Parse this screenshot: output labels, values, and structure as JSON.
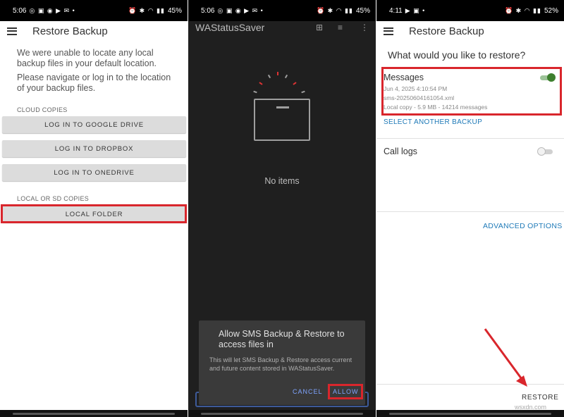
{
  "panel1": {
    "status": {
      "time": "5:06",
      "battery": "45%"
    },
    "appbar": {
      "title": "Restore Backup"
    },
    "message": {
      "line1": "We were unable to locate any local backup files in your default location.",
      "line2": "Please navigate or log in to the location of your backup files."
    },
    "cloud_label": "CLOUD COPIES",
    "buttons": [
      "LOG IN TO GOOGLE DRIVE",
      "LOG IN TO DROPBOX",
      "LOG IN TO ONEDRIVE"
    ],
    "local_label": "LOCAL OR SD COPIES",
    "local_button": "LOCAL FOLDER"
  },
  "panel2": {
    "status": {
      "time": "5:06",
      "battery": "45%"
    },
    "appbar": {
      "title": "WAStatusSaver"
    },
    "empty_text": "No items",
    "dialog": {
      "title": "Allow SMS Backup & Restore to access files in",
      "body": "This will let SMS Backup & Restore access current and future content stored in WAStatusSaver.",
      "cancel": "CANCEL",
      "allow": "ALLOW"
    }
  },
  "panel3": {
    "status": {
      "time": "4:11",
      "battery": "52%"
    },
    "appbar": {
      "title": "Restore Backup"
    },
    "question": "What would you like to restore?",
    "messages": {
      "title": "Messages",
      "date": "Jun 4, 2025 4:10:54 PM",
      "file": "sms-20250604161054.xml",
      "detail": "Local copy - 5.9 MB - 14214 messages",
      "enabled": true
    },
    "select_another": "SELECT ANOTHER BACKUP",
    "call_logs": {
      "title": "Call logs",
      "enabled": false
    },
    "advanced": "ADVANCED OPTIONS",
    "restore": "RESTORE"
  },
  "watermark": "wsxdn.com",
  "colors": {
    "highlight": "#d9262c",
    "toggle_on": "#3d7f2e",
    "link": "#1f7ab8",
    "dialog_button": "#7fa4ff"
  }
}
